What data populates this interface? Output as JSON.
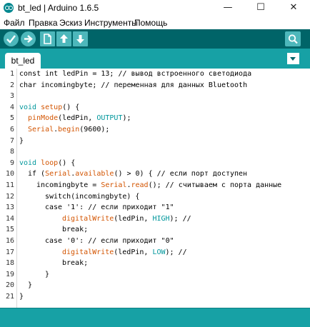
{
  "window": {
    "title": "bt_led | Arduino 1.6.5",
    "minimize_glyph": "—",
    "maximize_glyph": "☐",
    "close_glyph": "✕"
  },
  "menu": [
    "Файл",
    "Правка",
    "Эскиз",
    "Инструменты",
    "Помощь"
  ],
  "toolbar": {
    "buttons": [
      "verify-icon",
      "upload-icon",
      "new-icon",
      "open-icon",
      "save-icon"
    ],
    "right_button": "serial-monitor-icon"
  },
  "tabs": [
    {
      "label": "bt_led"
    }
  ],
  "colors": {
    "toolbar_bg": "#006468",
    "tabbar_bg": "#17a1a5",
    "button_bg": "#4db7bb",
    "keyword": "#00979c",
    "function": "#d35400"
  },
  "code": {
    "lines": [
      {
        "n": "1",
        "parts": [
          [
            "",
            "const int ledPin = 13; // вывод встроенного светодиода"
          ]
        ]
      },
      {
        "n": "2",
        "parts": [
          [
            "",
            "char incomingbyte; // переменная для данных Bluetooth"
          ]
        ]
      },
      {
        "n": "3",
        "parts": []
      },
      {
        "n": "4",
        "parts": [
          [
            "kw",
            "void"
          ],
          [
            "",
            " "
          ],
          [
            "fn",
            "setup"
          ],
          [
            "",
            "() {"
          ]
        ]
      },
      {
        "n": "5",
        "parts": [
          [
            "fn",
            "pinMode"
          ],
          [
            "",
            "(ledPin, "
          ],
          [
            "cst",
            "OUTPUT"
          ],
          [
            "",
            ");"
          ]
        ]
      },
      {
        "n": "6",
        "parts": [
          [
            "fn",
            "Serial"
          ],
          [
            "",
            "."
          ],
          [
            "fn",
            "begin"
          ],
          [
            "",
            "(9600);"
          ]
        ]
      },
      {
        "n": "7",
        "parts": [
          [
            "",
            "}"
          ]
        ]
      },
      {
        "n": "8",
        "parts": []
      },
      {
        "n": "9",
        "parts": [
          [
            "kw",
            "void"
          ],
          [
            "",
            " "
          ],
          [
            "fn",
            "loop"
          ],
          [
            "",
            "() {"
          ]
        ]
      },
      {
        "n": "10",
        "parts": [
          [
            "",
            "if ("
          ],
          [
            "fn",
            "Serial"
          ],
          [
            "",
            "."
          ],
          [
            "fn",
            "available"
          ],
          [
            "",
            "() > 0) { // если порт доступен"
          ]
        ]
      },
      {
        "n": "11",
        "parts": [
          [
            "",
            "incomingbyte = "
          ],
          [
            "fn",
            "Serial"
          ],
          [
            "",
            "."
          ],
          [
            "fn",
            "read"
          ],
          [
            "",
            "(); // считываем с порта данные"
          ]
        ]
      },
      {
        "n": "12",
        "parts": [
          [
            "",
            "switch(incomingbyte) {"
          ]
        ]
      },
      {
        "n": "13",
        "parts": [
          [
            "",
            "case '1': // если приходит \"1\""
          ]
        ]
      },
      {
        "n": "14",
        "parts": [
          [
            "fn",
            "digitalWrite"
          ],
          [
            "",
            "(ledPin, "
          ],
          [
            "cst",
            "HIGH"
          ],
          [
            "",
            "); //"
          ]
        ]
      },
      {
        "n": "15",
        "parts": [
          [
            "",
            "break;"
          ]
        ]
      },
      {
        "n": "16",
        "parts": [
          [
            "",
            "case '0': // если приходит \"0\""
          ]
        ]
      },
      {
        "n": "17",
        "parts": [
          [
            "fn",
            "digitalWrite"
          ],
          [
            "",
            "(ledPin, "
          ],
          [
            "cst",
            "LOW"
          ],
          [
            "",
            "); //"
          ]
        ]
      },
      {
        "n": "18",
        "parts": [
          [
            "",
            "break;"
          ]
        ]
      },
      {
        "n": "19",
        "parts": [
          [
            "",
            "}"
          ]
        ]
      },
      {
        "n": "20",
        "parts": [
          [
            "",
            "}"
          ]
        ]
      },
      {
        "n": "21",
        "parts": [
          [
            "",
            "}"
          ]
        ]
      }
    ]
  }
}
